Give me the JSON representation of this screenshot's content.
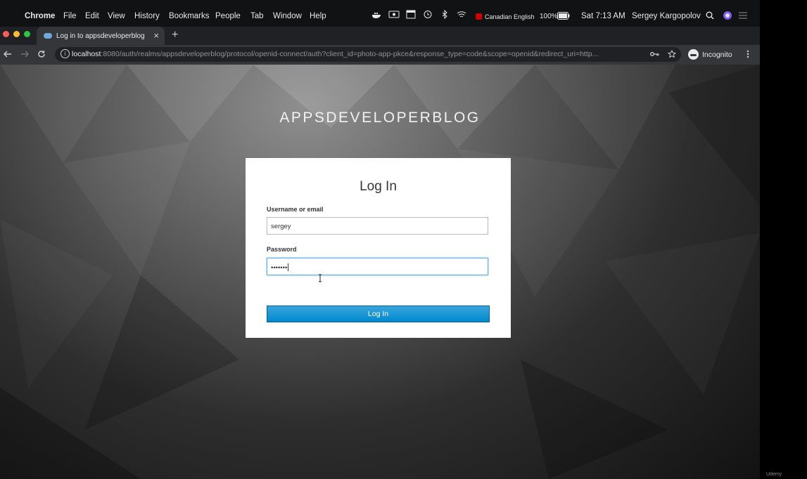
{
  "menubar": {
    "apple_icon": "apple-logo-icon",
    "app_name": "Chrome",
    "items": [
      "File",
      "Edit",
      "View",
      "History",
      "Bookmarks",
      "People",
      "Tab",
      "Window",
      "Help"
    ],
    "input_source": "Canadian English",
    "battery": "100%",
    "time": "Sat 7:13 AM",
    "user": "Sergey Kargopolov"
  },
  "tab": {
    "title": "Log in to appsdeveloperblog",
    "close": "×"
  },
  "newtab": "+",
  "toolbar": {
    "url_host": "localhost",
    "url_rest": ":8080/auth/realms/appsdeveloperblog/protocol/openid-connect/auth?client_id=photo-app-pkce&response_type=code&scope=openid&redirect_uri=http...",
    "incognito": "Incognito"
  },
  "page": {
    "realm_name": "APPSDEVELOPERBLOG",
    "form": {
      "title": "Log In",
      "username_label": "Username or email",
      "username_value": "sergey",
      "password_label": "Password",
      "password_value": "•••••••",
      "submit_label": "Log In"
    }
  },
  "watermark": "Udemy",
  "colors": {
    "button": "#0088ce",
    "focus_border": "#66afe9",
    "traffic_red": "#ff5f57",
    "traffic_yellow": "#febc2e",
    "traffic_green": "#28c840"
  }
}
